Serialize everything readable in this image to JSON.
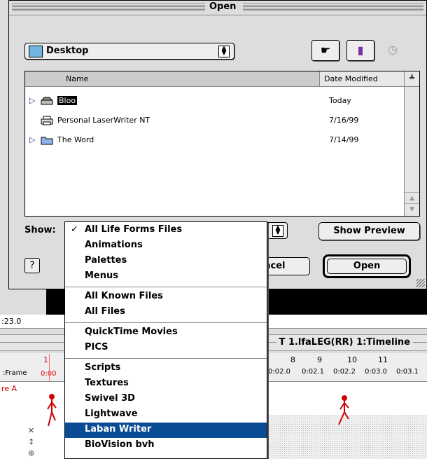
{
  "dialog": {
    "title": "Open",
    "folder_popup": "Desktop",
    "list_header": {
      "name": "Name",
      "date_modified": "Date Modified",
      "sort_icon": "≜"
    },
    "files": [
      {
        "name": "Bloo",
        "date": "Today",
        "icon": "disk-icon",
        "expandable": true,
        "selected": true
      },
      {
        "name": "Personal LaserWriter NT",
        "date": "7/16/99",
        "icon": "printer-icon",
        "expandable": false,
        "selected": false
      },
      {
        "name": "The Word",
        "date": "7/14/99",
        "icon": "folder-icon",
        "expandable": true,
        "selected": false
      }
    ],
    "show_label": "Show:",
    "show_preview": "Show Preview",
    "help": "?",
    "cancel": "Cancel",
    "cancel_visible": "ancel",
    "open": "Open"
  },
  "menu": {
    "items": [
      {
        "label": "All Life Forms  Files",
        "checked": true,
        "highlighted": false
      },
      {
        "label": "Animations",
        "checked": false,
        "highlighted": false
      },
      {
        "label": "Palettes",
        "checked": false,
        "highlighted": false
      },
      {
        "label": "Menus",
        "checked": false,
        "highlighted": false
      },
      {
        "label": "All Known Files",
        "checked": false,
        "highlighted": false
      },
      {
        "label": "All Files",
        "checked": false,
        "highlighted": false
      },
      {
        "label": "QuickTime Movies",
        "checked": false,
        "highlighted": false
      },
      {
        "label": "PICS",
        "checked": false,
        "highlighted": false
      },
      {
        "label": "Scripts",
        "checked": false,
        "highlighted": false
      },
      {
        "label": "Textures",
        "checked": false,
        "highlighted": false
      },
      {
        "label": "Swivel 3D",
        "checked": false,
        "highlighted": false
      },
      {
        "label": "Lightwave",
        "checked": false,
        "highlighted": false
      },
      {
        "label": "Laban Writer",
        "checked": false,
        "highlighted": true
      },
      {
        "label": "BioVision bvh",
        "checked": false,
        "highlighted": false
      }
    ],
    "highlight_color": "#0a4c94"
  },
  "timeline": {
    "time_readout": ":23.0",
    "window_title": "T 1.lfaLEG(RR) 1:Timeline",
    "frame_label": ":Frame",
    "track_label": "re A",
    "red_marker": {
      "frame": "1",
      "time": "0:00"
    },
    "ticks": [
      {
        "frame": "8",
        "time": "0:02.0"
      },
      {
        "frame": "9",
        "time": "0:02.1"
      },
      {
        "frame": "10",
        "time": "0:02.2"
      },
      {
        "frame": "11",
        "time": "0:03.0"
      },
      {
        "frame": "",
        "time": "0:03.1"
      }
    ],
    "accent_red": "#d00000"
  }
}
